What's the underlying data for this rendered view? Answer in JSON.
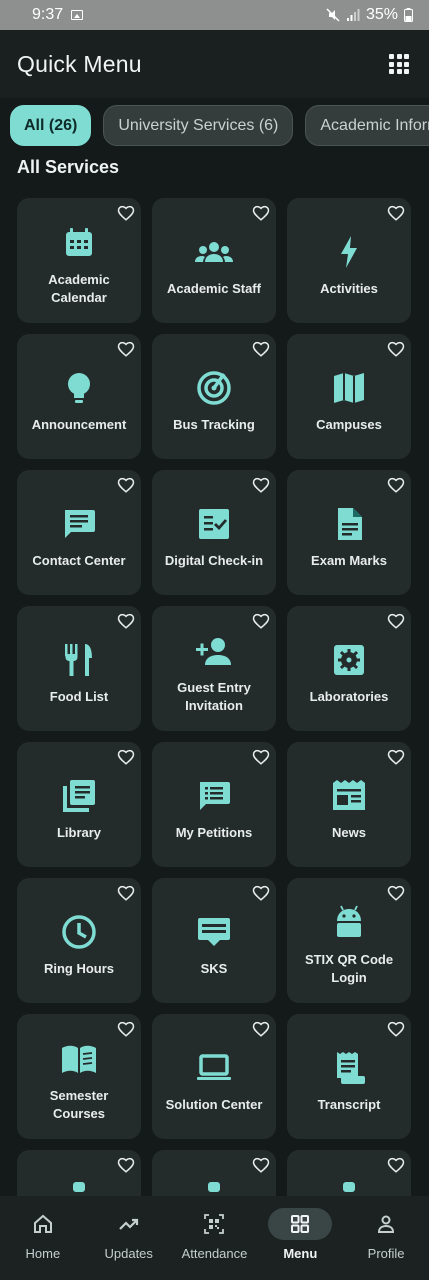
{
  "status": {
    "time": "9:37",
    "battery": "35%"
  },
  "header": {
    "title": "Quick Menu"
  },
  "chips": [
    {
      "label": "All (26)",
      "active": true
    },
    {
      "label": "University Services (6)",
      "active": false
    },
    {
      "label": "Academic Inform",
      "active": false
    }
  ],
  "section": {
    "title": "All Services"
  },
  "services": [
    {
      "label": "Academic Calendar",
      "icon": "calendar-icon"
    },
    {
      "label": "Academic Staff",
      "icon": "people-icon"
    },
    {
      "label": "Activities",
      "icon": "bolt-icon"
    },
    {
      "label": "Announcement",
      "icon": "lightbulb-icon"
    },
    {
      "label": "Bus Tracking",
      "icon": "radar-icon"
    },
    {
      "label": "Campuses",
      "icon": "map-icon"
    },
    {
      "label": "Contact Center",
      "icon": "chat-icon"
    },
    {
      "label": "Digital Check-in",
      "icon": "checklist-icon"
    },
    {
      "label": "Exam Marks",
      "icon": "document-icon"
    },
    {
      "label": "Food List",
      "icon": "restaurant-icon"
    },
    {
      "label": "Guest Entry Invitation",
      "icon": "person-add-icon"
    },
    {
      "label": "Laboratories",
      "icon": "settings-box-icon"
    },
    {
      "label": "Library",
      "icon": "library-icon"
    },
    {
      "label": "My Petitions",
      "icon": "petition-icon"
    },
    {
      "label": "News",
      "icon": "newspaper-icon"
    },
    {
      "label": "Ring Hours",
      "icon": "clock-icon"
    },
    {
      "label": "SKS",
      "icon": "credit-card-icon"
    },
    {
      "label": "STIX QR Code Login",
      "icon": "android-icon"
    },
    {
      "label": "Semester Courses",
      "icon": "book-icon"
    },
    {
      "label": "Solution Center",
      "icon": "laptop-icon"
    },
    {
      "label": "Transcript",
      "icon": "receipt-icon"
    },
    {
      "label": "",
      "icon": "partial-icon"
    },
    {
      "label": "",
      "icon": "partial-icon"
    },
    {
      "label": "",
      "icon": "partial-icon"
    }
  ],
  "nav": [
    {
      "label": "Home",
      "icon": "home-icon",
      "active": false
    },
    {
      "label": "Updates",
      "icon": "trending-icon",
      "active": false
    },
    {
      "label": "Attendance",
      "icon": "qr-scan-icon",
      "active": false
    },
    {
      "label": "Menu",
      "icon": "grid-menu-icon",
      "active": true
    },
    {
      "label": "Profile",
      "icon": "person-icon",
      "active": false
    }
  ],
  "colors": {
    "accent": "#7fdcd3",
    "background": "#141919",
    "card": "#242b2b"
  }
}
